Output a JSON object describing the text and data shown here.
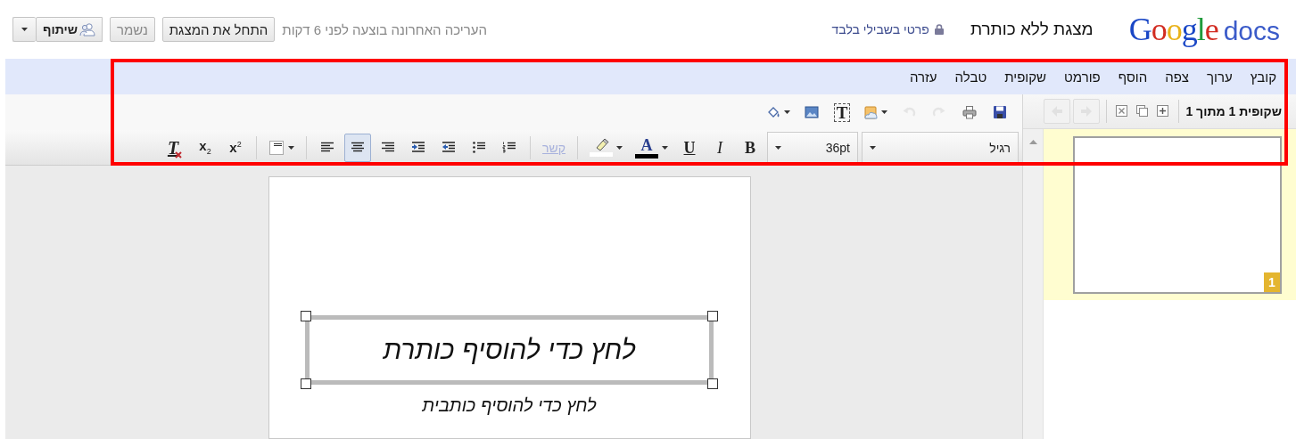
{
  "header": {
    "logo": {
      "brand": "Google",
      "product": "docs"
    },
    "doc_title": "מצגת ללא כותרת",
    "sharing": "פרטי בשבילי בלבד",
    "last_edit": "העריכה האחרונה בוצעה לפני 6 דקות",
    "buttons": [
      {
        "kind": "start",
        "label": "התחל את המצגת",
        "disabled": false
      },
      {
        "kind": "saved",
        "label": "נשמר",
        "disabled": true
      },
      {
        "kind": "share",
        "label": "שיתוף",
        "disabled": false
      }
    ]
  },
  "menu": [
    "קובץ",
    "ערוך",
    "צפה",
    "הוסף",
    "פורמט",
    "שקופית",
    "טבלה",
    "עזרה"
  ],
  "slide_toolbar": {
    "counter": "שקופית 1 מתוך 1",
    "items": [
      {
        "kind": "add",
        "disabled": false
      },
      {
        "kind": "duplicate",
        "disabled": false
      },
      {
        "kind": "delete",
        "disabled": false
      },
      {
        "kind": "separator"
      },
      {
        "kind": "next",
        "disabled": true
      },
      {
        "kind": "prev",
        "disabled": true
      }
    ]
  },
  "toolbar_top": [
    {
      "kind": "save",
      "disabled": false
    },
    {
      "kind": "print",
      "disabled": false
    },
    {
      "kind": "redo",
      "disabled": true
    },
    {
      "kind": "undo",
      "disabled": true
    },
    {
      "kind": "clipart",
      "disabled": false
    },
    {
      "kind": "textbox",
      "glyph": "T",
      "disabled": false
    },
    {
      "kind": "image",
      "disabled": false
    },
    {
      "kind": "fill",
      "disabled": false
    }
  ],
  "toolbar_format": [
    {
      "kind": "font",
      "value": "רגיל"
    },
    {
      "kind": "size",
      "value": "36pt"
    },
    {
      "kind": "bold",
      "glyph": "B"
    },
    {
      "kind": "italic",
      "glyph": "I"
    },
    {
      "kind": "underline",
      "glyph": "U"
    },
    {
      "kind": "text_color",
      "glyph": "A"
    },
    {
      "kind": "highlight"
    },
    {
      "kind": "separator"
    },
    {
      "kind": "link",
      "label": "קשר",
      "disabled": true
    },
    {
      "kind": "separator"
    },
    {
      "kind": "numbered_list"
    },
    {
      "kind": "bullet_list"
    },
    {
      "kind": "outdent"
    },
    {
      "kind": "indent"
    },
    {
      "kind": "align_right",
      "selected": false
    },
    {
      "kind": "align_center",
      "selected": true
    },
    {
      "kind": "align_left",
      "selected": false
    },
    {
      "kind": "separator"
    },
    {
      "kind": "border"
    },
    {
      "kind": "separator"
    },
    {
      "kind": "superscript",
      "glyph": "x$^{2}$"
    },
    {
      "kind": "subscript",
      "glyph": "x$_{2}$"
    },
    {
      "kind": "clear_format",
      "glyph": "T"
    }
  ],
  "slides": [
    {
      "number": "1",
      "selected": true
    }
  ],
  "slide": {
    "title_placeholder": "לחץ כדי להוסיף כותרת",
    "subtitle_placeholder": "לחץ כדי להוסיף כותבית",
    "title_selected": true
  },
  "annotations": [
    {
      "kind": "frame"
    }
  ]
}
